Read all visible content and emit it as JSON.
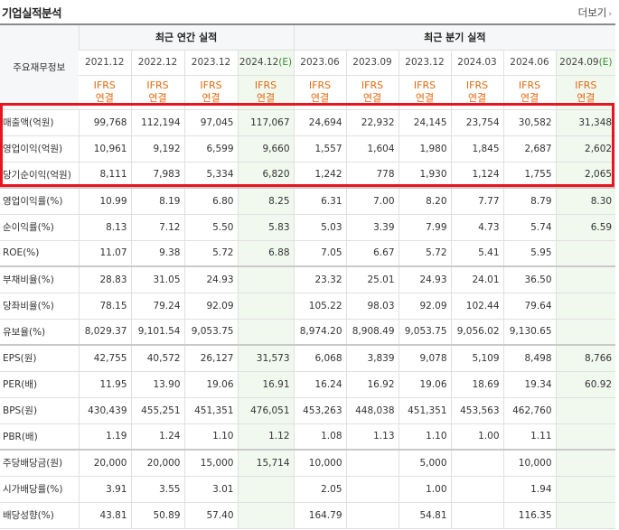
{
  "header": {
    "title": "기업실적분석",
    "more_label": "더보기",
    "more_icon": "chevron-right-icon"
  },
  "table": {
    "corner_label": "주요재무정보",
    "annual_group": "최근 연간 실적",
    "quarter_group": "최근 분기 실적",
    "periods": [
      "2021.12",
      "2022.12",
      "2023.12",
      "2024.12(E)",
      "2023.06",
      "2023.09",
      "2023.12",
      "2024.03",
      "2024.06",
      "2024.09(E)"
    ],
    "ifrs_line1": "IFRS",
    "ifrs_line2": "연결",
    "rows": [
      {
        "label": "매출액(억원)",
        "values": [
          "99,768",
          "112,194",
          "97,045",
          "117,067",
          "24,694",
          "22,932",
          "24,145",
          "23,754",
          "30,582",
          "31,348"
        ]
      },
      {
        "label": "영업이익(억원)",
        "values": [
          "10,961",
          "9,192",
          "6,599",
          "9,660",
          "1,557",
          "1,604",
          "1,980",
          "1,845",
          "2,687",
          "2,602"
        ]
      },
      {
        "label": "당기순이익(억원)",
        "values": [
          "8,111",
          "7,983",
          "5,334",
          "6,820",
          "1,242",
          "778",
          "1,930",
          "1,124",
          "1,755",
          "2,065"
        ]
      },
      {
        "label": "영업이익률(%)",
        "values": [
          "10.99",
          "8.19",
          "6.80",
          "8.25",
          "6.31",
          "7.00",
          "8.20",
          "7.77",
          "8.79",
          "8.30"
        ]
      },
      {
        "label": "순이익률(%)",
        "values": [
          "8.13",
          "7.12",
          "5.50",
          "5.83",
          "5.03",
          "3.39",
          "7.99",
          "4.73",
          "5.74",
          "6.59"
        ]
      },
      {
        "label": "ROE(%)",
        "values": [
          "11.07",
          "9.38",
          "5.72",
          "6.88",
          "7.05",
          "6.67",
          "5.72",
          "5.41",
          "5.95",
          ""
        ]
      },
      {
        "label": "부채비율(%)",
        "values": [
          "28.83",
          "31.05",
          "24.93",
          "",
          "23.32",
          "25.01",
          "24.93",
          "24.01",
          "36.50",
          ""
        ]
      },
      {
        "label": "당좌비율(%)",
        "values": [
          "78.15",
          "79.24",
          "92.09",
          "",
          "105.22",
          "98.03",
          "92.09",
          "102.44",
          "79.64",
          ""
        ]
      },
      {
        "label": "유보율(%)",
        "values": [
          "8,029.37",
          "9,101.54",
          "9,053.75",
          "",
          "8,974.20",
          "8,908.49",
          "9,053.75",
          "9,056.02",
          "9,130.65",
          ""
        ]
      },
      {
        "label": "EPS(원)",
        "values": [
          "42,755",
          "40,572",
          "26,127",
          "31,573",
          "6,068",
          "3,839",
          "9,078",
          "5,109",
          "8,498",
          "8,766"
        ]
      },
      {
        "label": "PER(배)",
        "values": [
          "11.95",
          "13.90",
          "19.06",
          "16.91",
          "16.24",
          "16.92",
          "19.06",
          "18.69",
          "19.34",
          "60.92"
        ]
      },
      {
        "label": "BPS(원)",
        "values": [
          "430,439",
          "455,251",
          "451,351",
          "476,051",
          "453,263",
          "448,038",
          "451,351",
          "453,563",
          "462,760",
          ""
        ]
      },
      {
        "label": "PBR(배)",
        "values": [
          "1.19",
          "1.24",
          "1.10",
          "1.12",
          "1.08",
          "1.13",
          "1.10",
          "1.00",
          "1.11",
          ""
        ]
      },
      {
        "label": "주당배당금(원)",
        "values": [
          "20,000",
          "20,000",
          "15,000",
          "15,714",
          "10,000",
          "",
          "5,000",
          "",
          "10,000",
          ""
        ]
      },
      {
        "label": "시가배당률(%)",
        "values": [
          "3.91",
          "3.55",
          "3.01",
          "",
          "2.05",
          "",
          "1.00",
          "",
          "1.94",
          ""
        ]
      },
      {
        "label": "배당성향(%)",
        "values": [
          "43.81",
          "50.89",
          "57.40",
          "",
          "164.79",
          "",
          "54.81",
          "",
          "116.35",
          ""
        ]
      }
    ],
    "highlight_color": "#e8141f"
  }
}
